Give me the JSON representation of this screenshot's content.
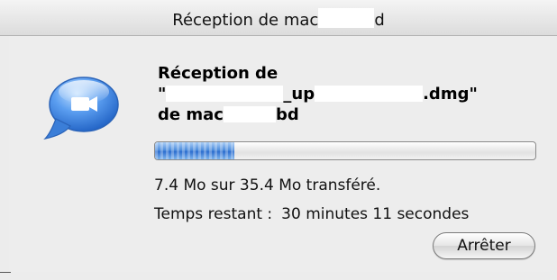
{
  "window": {
    "title_prefix": "Réception de mac",
    "title_suffix": "d"
  },
  "icon": "ichat-video-camera-icon",
  "message": {
    "line1": "Réception de",
    "file_open_quote": "\"",
    "file_mid": "_up",
    "file_ext": ".dmg\"",
    "sender_prefix": "de mac",
    "sender_suffix": "bd"
  },
  "progress": {
    "fraction": 0.209
  },
  "status": {
    "transfer": "7.4 Mo sur 35.4 Mo transféré.",
    "remaining_label": "Temps restant :",
    "remaining_value": "30 minutes 11 secondes"
  },
  "buttons": {
    "stop_label": "Arrêter"
  },
  "colors": {
    "progress_fill": "#3f7fd6",
    "window_bg": "#ececec",
    "icon_bubble": "#4a8fe0"
  }
}
